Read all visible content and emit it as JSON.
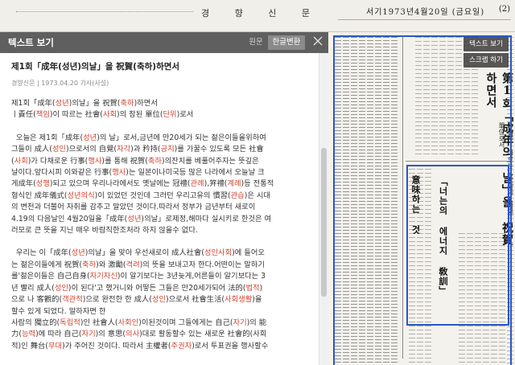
{
  "newspaper": {
    "masthead": "경 향 신 문",
    "dateline": "서기1973년4월20일 (금요일)",
    "page": "(2)",
    "vertical_headline": "第1회「成年의 날」을 祝賀하면서",
    "vertical_subheadline": "—責任 따르는 社會의 참된 單位로서",
    "inner_headline": "「너는의 에너지 敎訓」",
    "inner_subheadline": "意味하는 것"
  },
  "scan_buttons": {
    "text_view": "텍스트 보기",
    "scrap": "스크랩 하기"
  },
  "panel": {
    "title": "텍스트 보기",
    "tab_original": "원문",
    "tab_convert": "한글변환",
    "close_icon": "close-icon"
  },
  "article": {
    "title": "제1회「成年(성년)의날」을 祝賀(축하)하면서",
    "meta": "경향신문 | 1973.04.20 기사(사설)",
    "lines_p1": [
      "제1회「成年(성년)의날」을 祝賀(축하)하면서",
      "ㅣ責任(책임)이 따르는 社會(사회)의 참된 單位(단위)로서"
    ],
    "lines_p2": [
      "오늘은 제1회「成年(성년)의 날」로서,금년에 만20세가 되는 젊은이들을위하여",
      "그들이 成人(성인)으로서의 自覺(자각)과 矜持(긍지)를 가꿀수 있도록 모든 社會",
      "(사회)가 다채로운 行事(행사)를 통해 祝賀(축하)의잔치를 베풀어주자는 뜻깊은",
      "날이다.앞다시피 이와같은 行事(행사)는 일본이나미국등 많은 나라에서 오늘날 크",
      "게成年(성행)되고 있으며 우리나라에서도 옛날에는 冠禮(관례),笄禮(계례)등 전통적",
      "형식인 成年儀式(성년의식)이 있었던 것인데 그러던 우리고유의 慣習(관습)은 시대",
      "의 변천과 더불어 자취를 감추고 말았던 것이다.따라서 정부가 금년부터 새로이",
      "4.19의 다음날인 4월20일을「成年(성년)의날」로제정,해마다 실시키로 한것은 여",
      "러모로 큰 뜻을 지닌 매우 바람직한조처라 하지 않을수 없다."
    ],
    "lines_p3": [
      "우리는 이「成年(성년)의날」을 맞아 우선새로이 成人社會(성인사회)에 들어오",
      "는 젊은이들에게 祝賀(축하)와 激勵(격려)의 뜻을 보내고자 한다.어떤이는 말하기",
      "를'젊은이들은 自己自身(자기자신)이 알기보다는 3년늦게,어른들이 알기보다는 3",
      "년 빨리 成人(성인)이 된다'고 했거니와 어떻든 그들은 만20세가되어 法的(법적)",
      "으로 나 客觀的(객관적)으로 완전한 한 成人(성인)으로서 社會生活(사회생활)을",
      "할수 있게 되었다. 말하자면 한",
      "사람의 獨立的(독립적)인 社會人(사회인)이된것이며 그들에게는 自己(자기)의 能",
      "力(능력)에 따라 自己(자기)의 意思(의사)대로 활동할수 있는 새로운 社會的(사회",
      "적)인 舞台(무대)가 주어진 것이다. 따라서 主權者(주권자)로서 투표권을 행사할수"
    ]
  }
}
